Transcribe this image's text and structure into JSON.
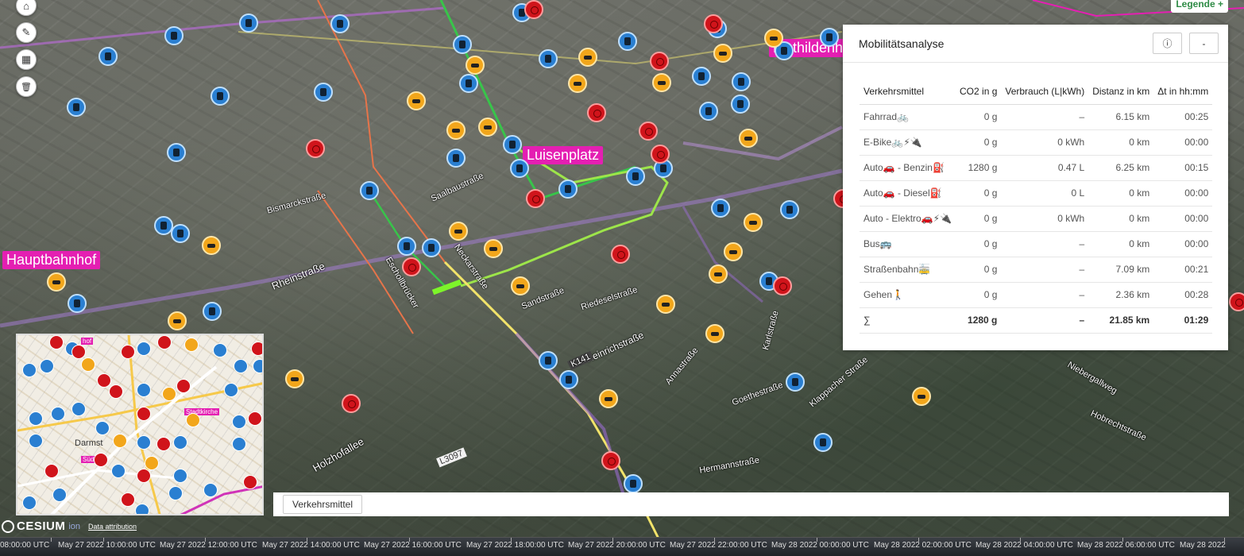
{
  "map": {
    "place_labels": [
      "Luisenplatz",
      "Hauptbahnhof",
      "Mathildenh"
    ],
    "street_labels": [
      "Rheinstraße",
      "Heinrichstraße",
      "Karlstraße",
      "Goethestraße",
      "Hermannstraße",
      "Holzhofallee",
      "Annastraße",
      "Klappacher Straße",
      "Hobrechtstraße",
      "Niebergallweg",
      "Riedeselstraße",
      "Saalbaustraße",
      "K141",
      "L3097",
      "Bismarckstraße",
      "Sandstraße",
      "Neckarstraße",
      "Eschollbrücker"
    ]
  },
  "toolbar": {
    "items": [
      {
        "name": "home",
        "icon": "home-icon",
        "glyph": "⌂"
      },
      {
        "name": "tools",
        "icon": "wrench-icon",
        "glyph": "✎"
      },
      {
        "name": "layers",
        "icon": "grid-icon",
        "glyph": "▦"
      },
      {
        "name": "delete",
        "icon": "trash-icon",
        "glyph": "🗑"
      }
    ]
  },
  "legend": {
    "label": "Legende +"
  },
  "panel": {
    "title": "Mobilitätsanalyse",
    "info_icon": "info-icon",
    "info_glyph": "ⓘ",
    "collapse_label": "-",
    "columns": [
      "Verkehrsmittel",
      "CO2 in g",
      "Verbrauch (L|kWh)",
      "Distanz in km",
      "Δt in hh:mm"
    ],
    "rows": [
      [
        "Fahrrad🚲",
        "0 g",
        "–",
        "6.15 km",
        "00:25"
      ],
      [
        "E-Bike🚲⚡🔌",
        "0 g",
        "0 kWh",
        "0 km",
        "00:00"
      ],
      [
        "Auto🚗 - Benzin⛽",
        "1280 g",
        "0.47 L",
        "6.25 km",
        "00:15"
      ],
      [
        "Auto🚗 - Diesel⛽",
        "0 g",
        "0 L",
        "0 km",
        "00:00"
      ],
      [
        "Auto - Elektro🚗⚡🔌",
        "0 g",
        "0 kWh",
        "0 km",
        "00:00"
      ],
      [
        "Bus🚌",
        "0 g",
        "–",
        "0 km",
        "00:00"
      ],
      [
        "Straßenbahn🚋",
        "0 g",
        "–",
        "7.09 km",
        "00:21"
      ],
      [
        "Gehen🚶",
        "0 g",
        "–",
        "2.36 km",
        "00:28"
      ]
    ],
    "sum": [
      "∑",
      "1280 g",
      "–",
      "21.85 km",
      "01:29"
    ]
  },
  "minimap": {
    "labels": [
      "hof",
      "Stadtkirche",
      "Darmst",
      "Süd"
    ]
  },
  "mode_bar": {
    "tab_label": "Verkehrsmittel"
  },
  "credits": {
    "logo": "CESIUM",
    "ion": "ion",
    "attribution": "Data attribution"
  },
  "timeline": {
    "labels": [
      "08:00:00 UTC",
      "May 27 2022 10:00:00 UTC",
      "May 27 2022 12:00:00 UTC",
      "May 27 2022 14:00:00 UTC",
      "May 27 2022 16:00:00 UTC",
      "May 27 2022 18:00:00 UTC",
      "May 27 2022 20:00:00 UTC",
      "May 27 2022 22:00:00 UTC",
      "May 28 2022 00:00:00 UTC",
      "May 28 2022 02:00:00 UTC",
      "May 28 2022 04:00:00 UTC",
      "May 28 2022 06:00:00 UTC",
      "May 28 2022"
    ]
  },
  "colors": {
    "accent_pink": "#e41fb2",
    "legend_green": "#2e8b45",
    "bus_blue": "#2a7fd1",
    "taxi_orange": "#f2a61b",
    "station_red": "#d0141b"
  }
}
